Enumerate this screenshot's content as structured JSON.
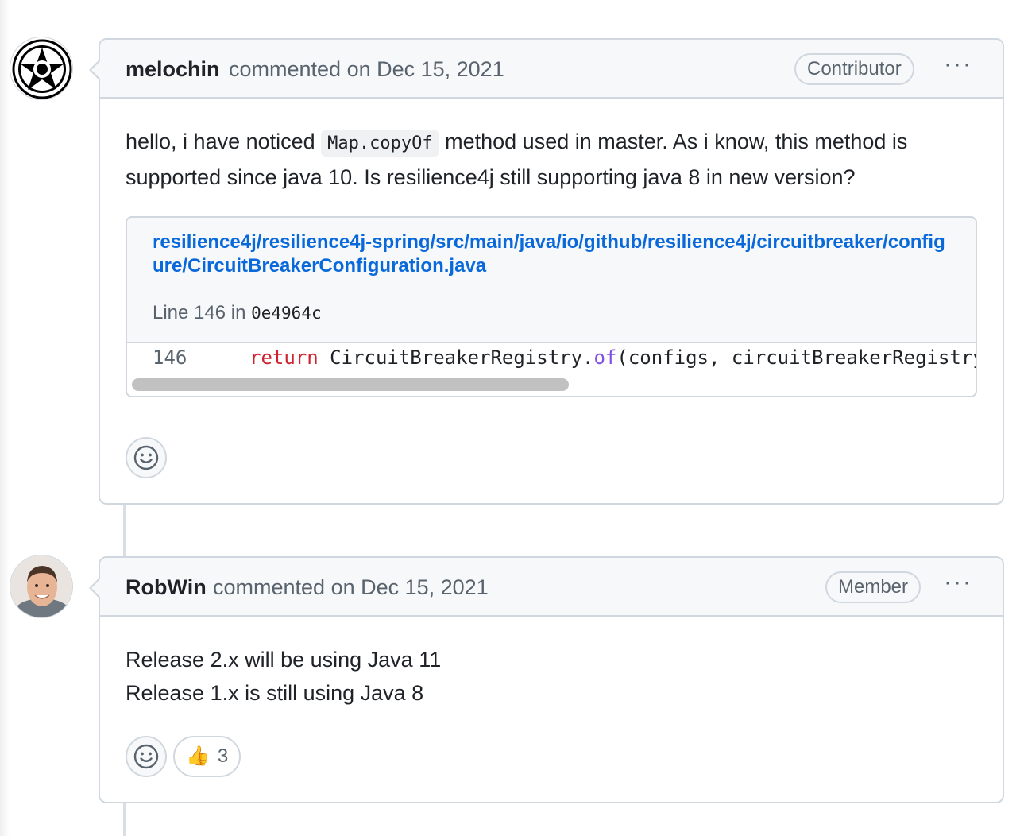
{
  "comments": [
    {
      "author": "melochin",
      "action": "commented on Dec 15, 2021",
      "role_badge": "Contributor",
      "more_label": "···",
      "body_part1": "hello, i have noticed ",
      "inline_code": "Map.copyOf",
      "body_part2": " method used in master. As i know, this method is supported since java 10. Is resilience4j still supporting java 8 in new version?",
      "snippet": {
        "path": "resilience4j/resilience4j-spring/src/main/java/io/github/resilience4j/circuitbreaker/configure/CircuitBreakerConfiguration.java",
        "line_prefix": "Line 146 in ",
        "commit": "0e4964c",
        "line_number": "146",
        "code_keyword": "return",
        "code_before_call": " CircuitBreakerRegistry.",
        "code_method": "of",
        "code_after": "(configs, circuitBreakerRegistryEventConsumer"
      },
      "reactions": []
    },
    {
      "author": "RobWin",
      "action": "commented on Dec 15, 2021",
      "role_badge": "Member",
      "more_label": "···",
      "body_lines": [
        "Release 2.x will be using Java 11",
        "Release 1.x is still using Java 8"
      ],
      "reactions": [
        {
          "emoji": "👍",
          "icon": "thumbs-up-icon",
          "count": "3"
        }
      ]
    }
  ],
  "colors": {
    "link": "#0969da",
    "keyword": "#cf222e",
    "method": "#8250df",
    "border": "#d0d7de",
    "header_bg": "#f6f8fa"
  }
}
